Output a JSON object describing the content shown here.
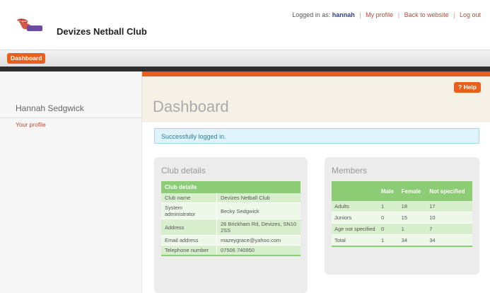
{
  "header": {
    "club_name": "Devizes Netball Club",
    "logged_in_prefix": "Logged in as:",
    "username": "hannah",
    "links": [
      "My profile",
      "Back to website",
      "Log out"
    ]
  },
  "nav": {
    "active_tab": "Dashboard"
  },
  "sidebar": {
    "user_name": "Hannah Sedgwick",
    "links": [
      "Your profile"
    ]
  },
  "main": {
    "help_label": "? Help",
    "title": "Dashboard",
    "alert": "Successfully logged in."
  },
  "club_details": {
    "panel_title": "Club details",
    "table_header": "Club details",
    "rows": [
      {
        "label": "Club name",
        "value": "Devizes Netball Club"
      },
      {
        "label": "System administrator",
        "value": "Becky Sedgwick"
      },
      {
        "label": "Address",
        "value": "26 Brickham Rd, Devizes, SN10 2SS"
      },
      {
        "label": "Email address",
        "value": "mazeygrace@yahoo.com"
      },
      {
        "label": "Telephone number",
        "value": "07506 740950"
      }
    ]
  },
  "members": {
    "panel_title": "Members",
    "columns": [
      "",
      "Male",
      "Female",
      "Not specified"
    ],
    "rows": [
      {
        "label": "Adults",
        "male": "1",
        "female": "18",
        "not_specified": "17"
      },
      {
        "label": "Juniors",
        "male": "0",
        "female": "15",
        "not_specified": "10"
      },
      {
        "label": "Age not specified",
        "male": "0",
        "female": "1",
        "not_specified": "7"
      },
      {
        "label": "Total",
        "male": "1",
        "female": "34",
        "not_specified": "34"
      }
    ]
  },
  "colors": {
    "accent": "#e8601c",
    "table_green": "#8ccc75",
    "alert_bg": "#dff3fb"
  }
}
